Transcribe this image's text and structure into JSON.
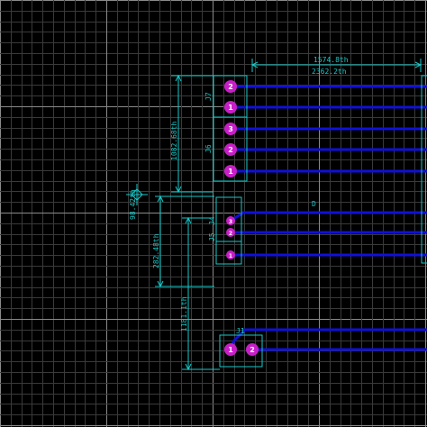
{
  "view": {
    "background": "#000000",
    "grid_color": "#3a3a3a",
    "major_grid_color": "#8a8a8a",
    "trace_color": "#1010d8",
    "silk_color": "#19c7c7",
    "pad_color": "#c81ec8"
  },
  "dimensions": {
    "horizontal_top": "1574.8th",
    "horizontal_bottom": "2362.2th",
    "vertical_j6_j7": "1082.68th",
    "vertical_j4_j5": "282.48th",
    "vertical_j1": "1181.1th",
    "origin_marker": "98.42th"
  },
  "connectors": [
    {
      "ref": "J7",
      "pins": [
        "2",
        "1"
      ]
    },
    {
      "ref": "J6",
      "pins": [
        "3",
        "2",
        "1"
      ]
    },
    {
      "ref": "J4",
      "pins": [
        "3",
        "2",
        "1"
      ]
    },
    {
      "ref": "J5",
      "pins": []
    },
    {
      "ref": "J1",
      "pins": [
        "1",
        "2"
      ]
    }
  ],
  "extra_label": "D"
}
